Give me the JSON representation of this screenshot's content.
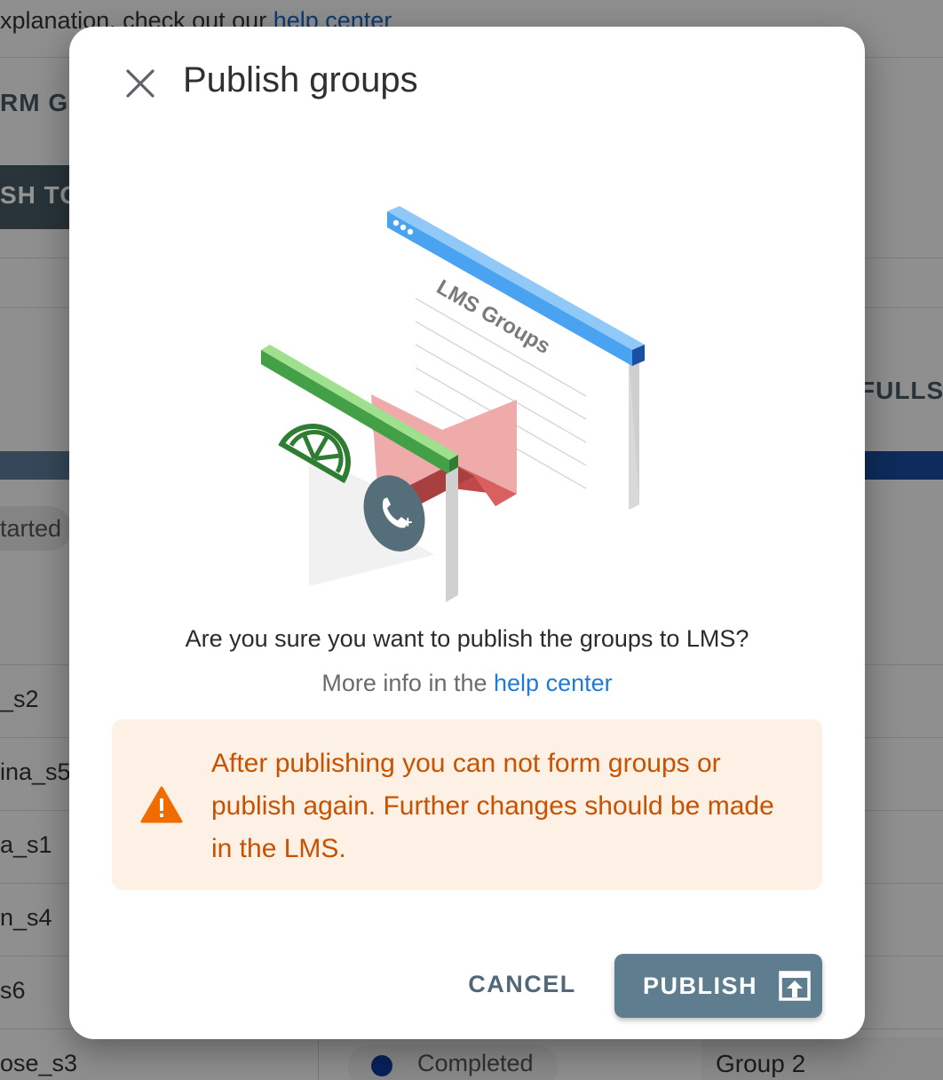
{
  "background": {
    "intro_text": "xplanation, check out our",
    "intro_link": "help center",
    "form_groups_label": "RM GR",
    "publish_button_label": "SH TO",
    "fullscreen_label": "FULLSC",
    "status_chip_label": "tarted",
    "rows": [
      "_s2",
      "ina_s5",
      "a_s1",
      "n_s4",
      "s6",
      "ose_s3"
    ],
    "completed_label": "Completed",
    "group_label": "Group 2"
  },
  "dialog": {
    "title": "Publish groups",
    "close_icon": "close-icon",
    "illustration": {
      "window_label": "LMS Groups"
    },
    "question": "Are you sure you want to publish the groups to LMS?",
    "more_info_prefix": "More info in the",
    "more_info_link": "help center",
    "warning": {
      "icon": "warning-icon",
      "text": "After publishing you can not form groups or publish again. Further changes should be made in the LMS."
    },
    "actions": {
      "cancel_label": "CANCEL",
      "publish_label": "PUBLISH",
      "publish_icon": "publish-icon"
    }
  },
  "colors": {
    "warning_text": "#c85200",
    "warning_bg": "#fdf0e5",
    "link": "#1e7bd8",
    "publish_button": "#5e7d8e",
    "cancel_text": "#52687a"
  }
}
